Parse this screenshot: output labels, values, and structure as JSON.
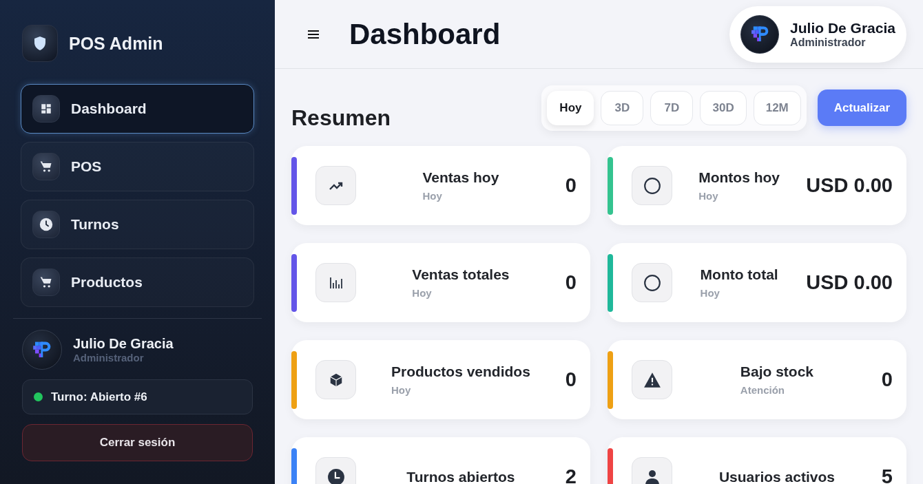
{
  "sidebar": {
    "brand": "POS Admin",
    "items": [
      {
        "label": "Dashboard",
        "selected": true
      },
      {
        "label": "POS",
        "selected": false
      },
      {
        "label": "Turnos",
        "selected": false
      },
      {
        "label": "Productos",
        "selected": false
      }
    ],
    "user": {
      "name": "Julio De Gracia",
      "role": "Administrador"
    },
    "shift": {
      "label": "Turno: Abierto #6",
      "color": "#22c55e"
    },
    "logout": "Cerrar sesión"
  },
  "header": {
    "title": "Dashboard",
    "user": {
      "name": "Julio De Gracia",
      "role": "Administrador"
    }
  },
  "summary": {
    "title": "Resumen",
    "ranges": [
      {
        "label": "Hoy",
        "selected": true
      },
      {
        "label": "3D",
        "selected": false
      },
      {
        "label": "7D",
        "selected": false
      },
      {
        "label": "30D",
        "selected": false
      },
      {
        "label": "12M",
        "selected": false
      }
    ],
    "refresh": "Actualizar"
  },
  "cards": [
    {
      "title": "Ventas hoy",
      "subtitle": "Hoy",
      "value": "0",
      "color": "#6355e8"
    },
    {
      "title": "Montos hoy",
      "subtitle": "Hoy",
      "value": "USD 0.00",
      "color": "#34c38f"
    },
    {
      "title": "Ventas totales",
      "subtitle": "Hoy",
      "value": "0",
      "color": "#6355e8"
    },
    {
      "title": "Monto total",
      "subtitle": "Hoy",
      "value": "USD 0.00",
      "color": "#1fb89a"
    },
    {
      "title": "Productos vendidos",
      "subtitle": "Hoy",
      "value": "0",
      "color": "#eea014"
    },
    {
      "title": "Bajo stock",
      "subtitle": "Atención",
      "value": "0",
      "color": "#eea014"
    },
    {
      "title": "Turnos abiertos",
      "value": "2",
      "color": "#3b82f6"
    },
    {
      "title": "Usuarios activos",
      "value": "5",
      "color": "#ef4444"
    }
  ]
}
